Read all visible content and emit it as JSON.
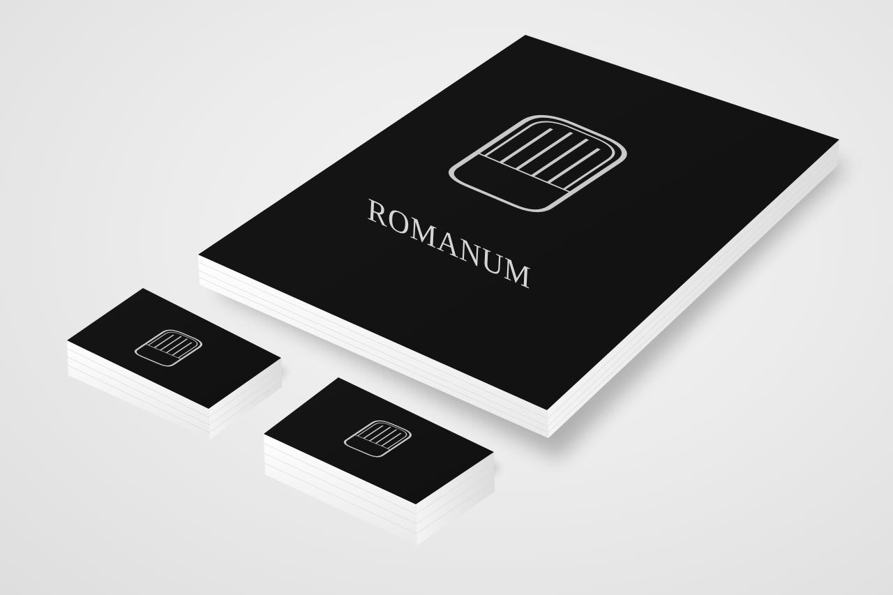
{
  "scene": {
    "description_free": true,
    "background_color": "#ececec",
    "print_color": "#141414",
    "logo_color": "#c9c9c9",
    "paper_edge_color": "#ffffff"
  },
  "poster": {
    "brand_name": "ROMANUM",
    "logo_icon": "romanum-monogram-icon"
  },
  "business_cards": [
    {
      "logo_icon": "romanum-monogram-icon"
    },
    {
      "logo_icon": "romanum-monogram-icon"
    }
  ]
}
